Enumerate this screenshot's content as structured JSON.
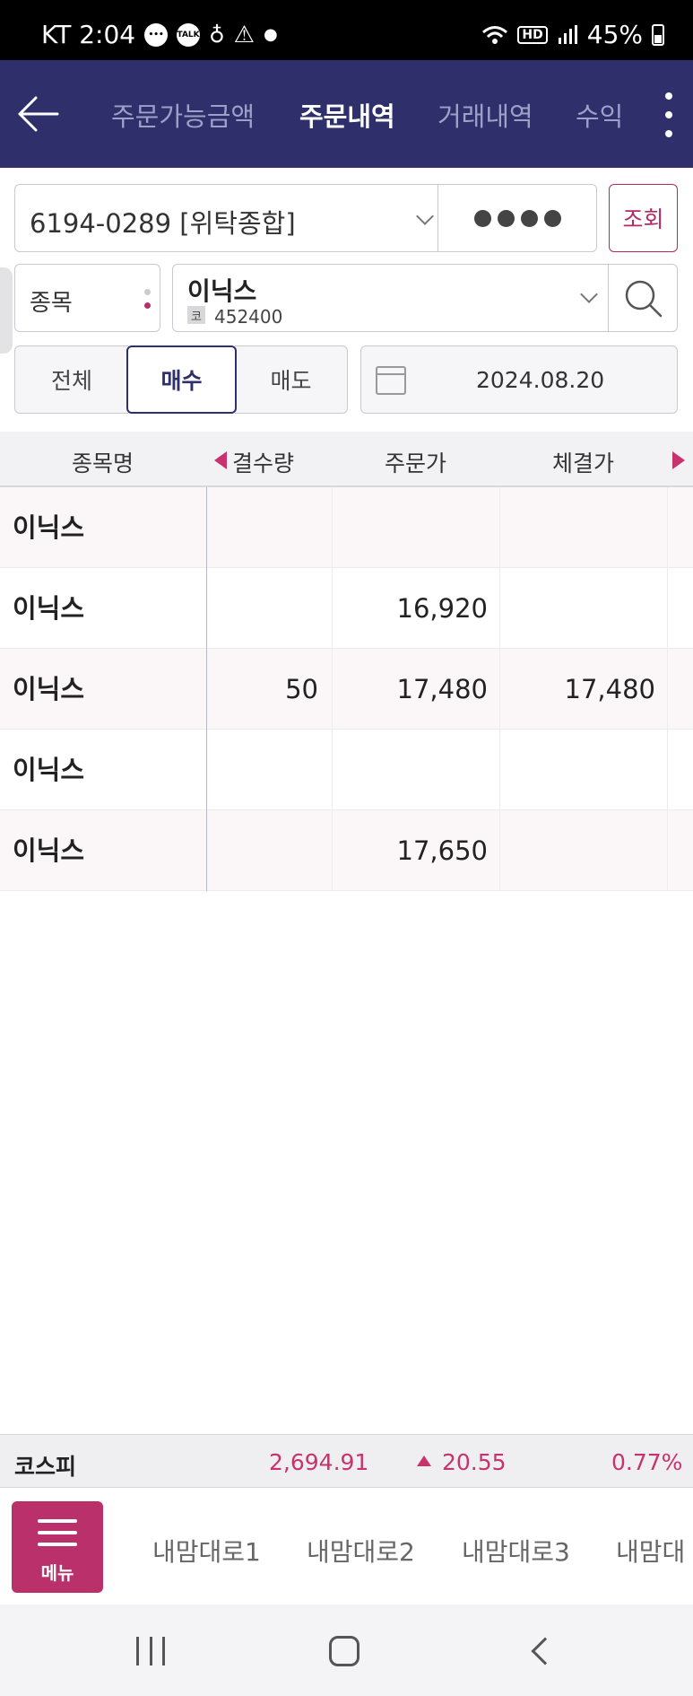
{
  "status_bar": {
    "carrier_time": "KT 2:04",
    "talk_badge": "TALK",
    "hd_badge": "HD",
    "battery": "45%"
  },
  "header": {
    "tabs": [
      {
        "label": "주문가능금액"
      },
      {
        "label": "주문내역"
      },
      {
        "label": "거래내역"
      },
      {
        "label": "수익"
      }
    ],
    "active_tab_index": 1
  },
  "account": {
    "value": "6194-0289 [위탁종합]",
    "password_mask": "●●●●",
    "query_label": "조회"
  },
  "stock": {
    "label": "종목",
    "name": "이닉스",
    "code_prefix": "코",
    "code": "452400"
  },
  "filters": {
    "options": [
      "전체",
      "매수",
      "매도"
    ],
    "selected": "매수",
    "date": "2024.08.20"
  },
  "table": {
    "headers": [
      "종목명",
      "결수량",
      "주문가",
      "체결가"
    ],
    "rows": [
      {
        "name": "이닉스",
        "qty": "",
        "order_price": "",
        "exec_price": ""
      },
      {
        "name": "이닉스",
        "qty": "",
        "order_price": "16,920",
        "exec_price": ""
      },
      {
        "name": "이닉스",
        "qty": "50",
        "order_price": "17,480",
        "exec_price": "17,480"
      },
      {
        "name": "이닉스",
        "qty": "",
        "order_price": "",
        "exec_price": ""
      },
      {
        "name": "이닉스",
        "qty": "",
        "order_price": "17,650",
        "exec_price": ""
      }
    ]
  },
  "market": {
    "name": "코스피",
    "index": "2,694.91",
    "change": "20.55",
    "rate": "0.77%",
    "up_color": "#c8326e"
  },
  "bottom_menu": {
    "menu_label": "메뉴",
    "shortcuts": [
      "내맘대로1",
      "내맘대로2",
      "내맘대로3",
      "내맘대"
    ]
  },
  "colors": {
    "header_bg": "#2e2f6b",
    "accent": "#b9306a"
  }
}
